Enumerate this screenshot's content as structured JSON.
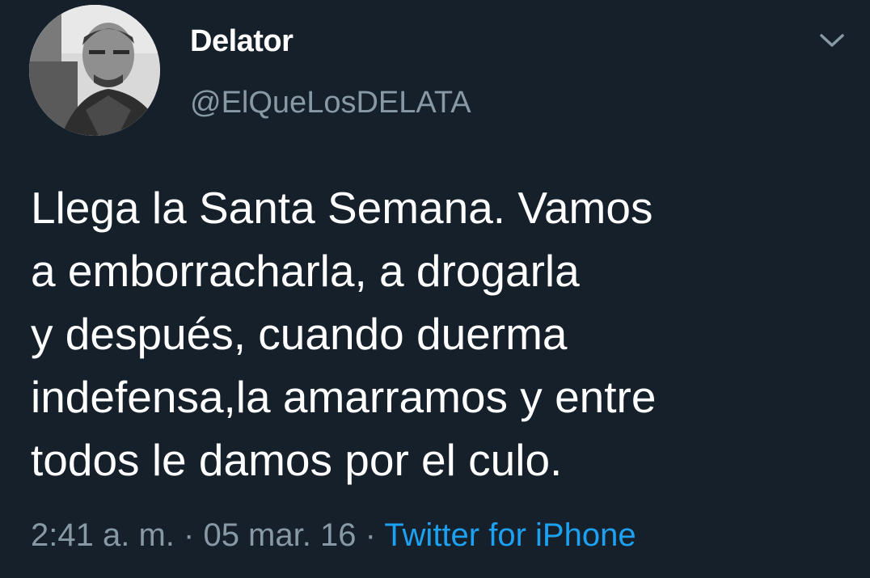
{
  "tweet": {
    "author": {
      "display_name": "Delator",
      "handle": "@ElQueLosDELATA",
      "avatar_icon": "profile-photo"
    },
    "menu_icon": "chevron-down-icon",
    "text_lines": [
      "Llega la Santa Semana. Vamos",
      "a emborracharla, a drogarla",
      "y después, cuando duerma",
      "indefensa,la amarramos y entre",
      "todos le damos por el culo."
    ],
    "time": "2:41 a. m.",
    "separator": "·",
    "date": "05 mar. 16",
    "source": "Twitter for iPhone"
  },
  "colors": {
    "background": "#15202b",
    "primary_text": "#ffffff",
    "secondary_text": "#8899a6",
    "link": "#1da1f2"
  }
}
